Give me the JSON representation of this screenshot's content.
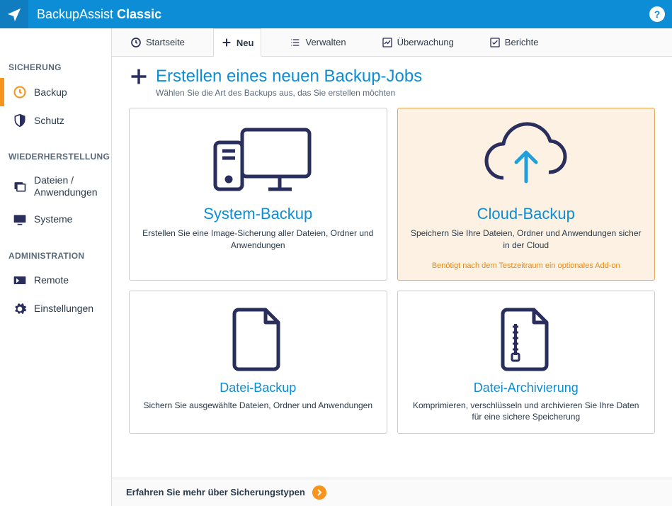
{
  "app": {
    "name_light": "BackupAssist ",
    "name_bold": "Classic"
  },
  "sidebar": {
    "sections": [
      {
        "label": "SICHERUNG",
        "items": [
          {
            "label": "Backup",
            "icon": "clock",
            "active": true
          },
          {
            "label": "Schutz",
            "icon": "shield"
          }
        ]
      },
      {
        "label": "WIEDERHERSTELLUNG",
        "items": [
          {
            "label": "Dateien / Anwendungen",
            "icon": "files"
          },
          {
            "label": "Systeme",
            "icon": "monitor"
          }
        ]
      },
      {
        "label": "ADMINISTRATION",
        "items": [
          {
            "label": "Remote",
            "icon": "remote"
          },
          {
            "label": "Einstellungen",
            "icon": "gear"
          }
        ]
      }
    ]
  },
  "tabs": [
    {
      "label": "Startseite",
      "icon": "clock"
    },
    {
      "label": "Neu",
      "icon": "plus",
      "active": true
    },
    {
      "label": "Verwalten",
      "icon": "list"
    },
    {
      "label": "Überwachung",
      "icon": "chart"
    },
    {
      "label": "Berichte",
      "icon": "check"
    }
  ],
  "page": {
    "title": "Erstellen eines neuen Backup-Jobs",
    "subtitle": "Wählen Sie die Art des Backups aus, das Sie erstellen möchten"
  },
  "cards": {
    "system": {
      "title": "System-Backup",
      "desc": "Erstellen Sie eine Image-Sicherung aller Dateien, Ordner und Anwendungen"
    },
    "cloud": {
      "title": "Cloud-Backup",
      "desc": "Speichern Sie Ihre Dateien, Ordner und Anwendungen sicher in der Cloud",
      "note": "Benötigt nach dem Testzeitraum ein optionales Add-on"
    },
    "file": {
      "title": "Datei-Backup",
      "desc": "Sichern Sie ausgewählte Dateien, Ordner und Anwendungen"
    },
    "archive": {
      "title": "Datei-Archivierung",
      "desc": "Komprimieren, verschlüsseln und archivieren Sie Ihre Daten für eine sichere Speicherung"
    }
  },
  "footer": {
    "text": "Erfahren Sie mehr über Sicherungstypen"
  }
}
